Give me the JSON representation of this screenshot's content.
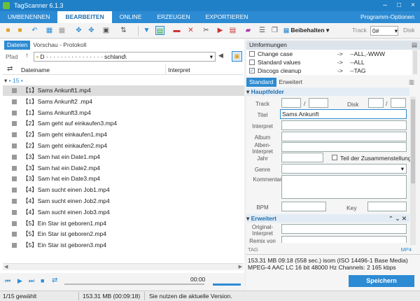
{
  "app": {
    "title": "TagScanner 6.1.3"
  },
  "menu": {
    "items": [
      "UMBENENNEN",
      "BEARBEITEN",
      "ONLINE",
      "ERZEUGEN",
      "EXPORTIEREN"
    ],
    "options": "Programm-Optionen"
  },
  "toolbar": {
    "mode": "Beibehalten",
    "track_label": "Track",
    "track_value": "0#",
    "disk_label": "Disk"
  },
  "left": {
    "tabs": [
      "Dateien",
      "Vorschau - Protokoll"
    ],
    "path_label": "Pfad",
    "path_value": "D · · · · · · · · · · · · · · · · schland\\",
    "columns": [
      "Dateiname",
      "Interpret"
    ],
    "group": "15",
    "files": [
      "【1】Sams Ankunft1.mp4",
      "【1】Sams Ankunft2 .mp4",
      "【1】Sams Ankunft3.mp4",
      "【2】Sam geht auf einkaufen3.mp4",
      "【2】Sam geht einkaufen1.mp4",
      "【2】Sam geht einkaufen2.mp4",
      "【3】Sam hat ein Date1.mp4",
      "【3】Sam hat ein Date2.mp4",
      "【3】Sam hat ein Date3.mp4",
      "【4】Sam sucht einen Job1.mp4",
      "【4】Sam sucht einen Job2.mp4",
      "【4】Sam sucht einen Job3.mp4",
      "【5】Ein Star ist geboren1.mp4",
      "【5】Ein Star ist geboren2.mp4",
      "【5】Ein Star ist geboren3.mp4"
    ],
    "time": "00:00"
  },
  "right": {
    "umformungen": "Umformungen",
    "transforms": [
      {
        "name": "Change case",
        "value": "--ALL,-WWW",
        "checked": false
      },
      {
        "name": "Standard values",
        "value": "--ALL",
        "checked": false
      },
      {
        "name": "Discogs cleanup",
        "value": "--TAG",
        "checked": true
      }
    ],
    "tabs": [
      "Standard",
      "Erweitert"
    ],
    "sect_main": "Hauptfelder",
    "labels": {
      "track": "Track",
      "disk": "Disk",
      "title": "Titel",
      "artist": "Interpret",
      "album": "Album",
      "album_artist": "Alben-Interpret",
      "year": "Jahr",
      "compilation": "Teil der Zusammenstellung",
      "genre": "Genre",
      "comment": "Kommentar",
      "bpm": "BPM",
      "key": "Key"
    },
    "title_value": "Sams Ankunft",
    "sect_ext": "Erweitert",
    "ext_labels": {
      "orig_artist": "Original-Interpret",
      "remix": "Remix von"
    },
    "tag": "TAG",
    "format": "MP4",
    "info1": "153.31 MB  09:18 (558 sec.)  isom (ISO 14496-1 Base Media)",
    "info2": "MPEG-4 AAC LC  16 bit  48000 Hz  Channels: 2  165 kbps",
    "save": "Speichern"
  },
  "status": {
    "selected": "1/15 gewählt",
    "size": "153.31 MB (00:09:18)",
    "version": "Sie nutzen die aktuelle Version."
  },
  "colors": {
    "accent": "#2d8bd3"
  }
}
